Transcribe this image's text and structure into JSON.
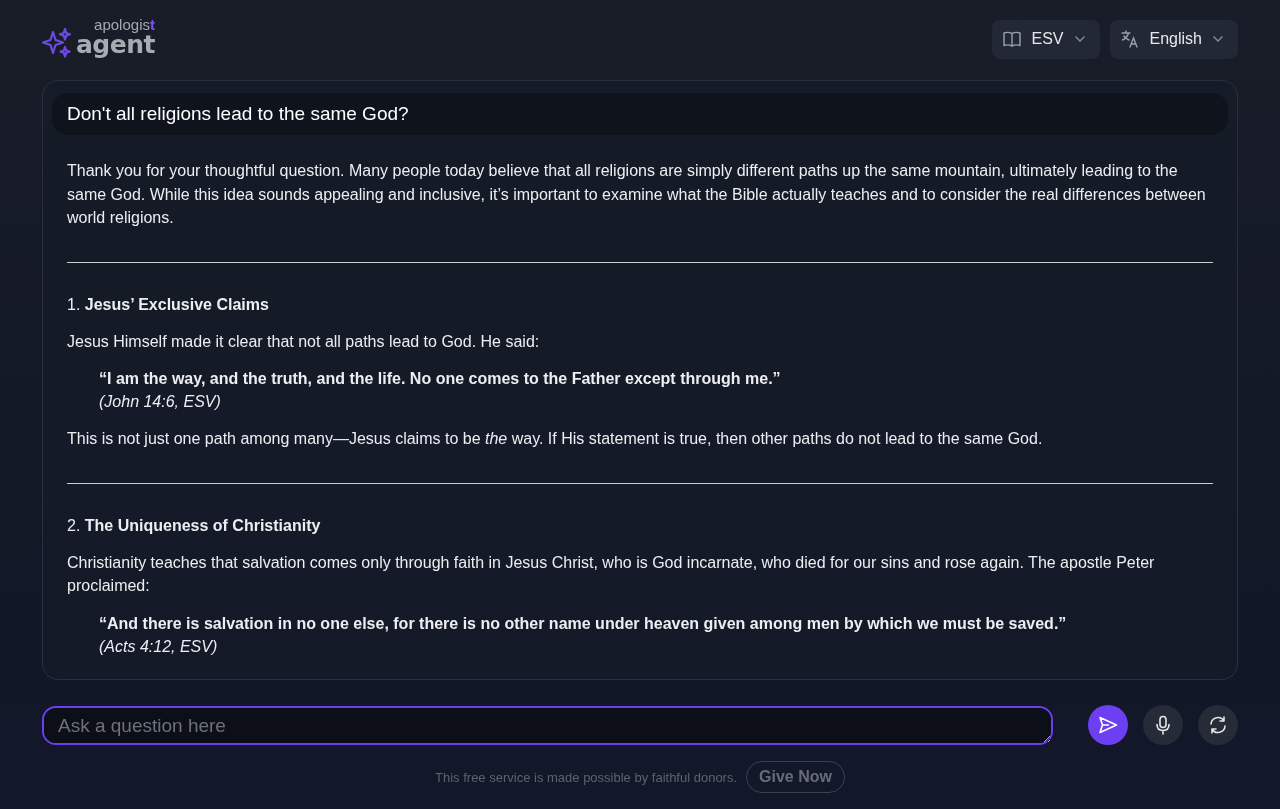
{
  "logo": {
    "top": "apologis",
    "top_accent": "t",
    "bottom": "agent"
  },
  "selectors": [
    {
      "kind": "bible",
      "label": "ESV"
    },
    {
      "kind": "language",
      "label": "English"
    }
  ],
  "question": "Don't all religions lead to the same God?",
  "answer": [
    {
      "kind": "paragraph",
      "text": "Thank you for your thoughtful question. Many people today believe that all religions are simply different paths up the same mountain, ultimately leading to the same God. While this idea sounds appealing and inclusive, it’s important to examine what the Bible actually teaches and to consider the real differences between world religions."
    },
    {
      "kind": "divider"
    },
    {
      "kind": "heading",
      "text": "1. **Jesus’ Exclusive Claims**"
    },
    {
      "kind": "paragraph",
      "text": "Jesus Himself made it clear that not all paths lead to God. He said:"
    },
    {
      "kind": "quote",
      "text": "“I am the way, and the truth, and the life. No one comes to the Father except through me.”",
      "reference": "(John 14:6, ESV)"
    },
    {
      "kind": "paragraph",
      "text": "This is not just one path among many—Jesus claims to be *the* way. If His statement is true, then other paths do not lead to the same God."
    },
    {
      "kind": "divider"
    },
    {
      "kind": "heading",
      "text": "2. **The Uniqueness of Christianity**"
    },
    {
      "kind": "paragraph",
      "text": "Christianity teaches that salvation comes only through faith in Jesus Christ, who is God incarnate, who died for our sins and rose again. The apostle Peter proclaimed:"
    },
    {
      "kind": "quote",
      "text": "“And there is salvation in no one else, for there is no other name under heaven given among men by which we must be saved.”",
      "reference": "(Acts 4:12, ESV)"
    }
  ],
  "input": {
    "placeholder": "Ask a question here"
  },
  "footer": {
    "text": "This free service is made possible by faithful donors.",
    "button": "Give Now"
  }
}
